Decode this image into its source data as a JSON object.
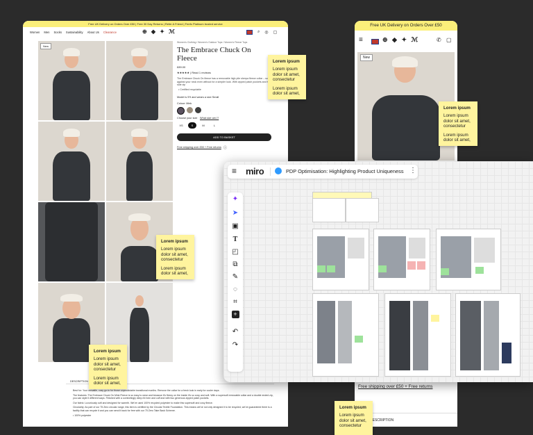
{
  "desktop": {
    "promo": "Free UK Delivery on Orders Over £50 | Free 30 Day Returns | Refer A Friend | Feefo Platinum trusted service",
    "nav": [
      "Women",
      "Men",
      "Socks",
      "Sustainability",
      "About Us",
      "Clearance"
    ],
    "logo": "⊕ ◆ ✦ ℳ",
    "new_badge": "New",
    "breadcrumb": "Women's Clothing / Women's Outdoor Tops / Women's Fleece Tops",
    "product_title": "The Embrace Chuck On Fleece",
    "price": "£89.00",
    "reviews": "★★★★★ | Read 1 reviews",
    "description": "The Embrace Chuck On fleece has a removable high pile sherpa fleece collar – so cosy against your neck even without for a simpler look. With zipped patch pockets and two side zip",
    "bullet": "• Certified recyclable",
    "model_text": "Model is 5'9 and wears a size Small",
    "colour_label": "Colour: Mink",
    "size_label": "Choose your size",
    "size_guide": "What size am I?",
    "sizes": [
      "XS",
      "S",
      "M",
      "L"
    ],
    "add_to_basket": "ADD TO BASKET",
    "free_shipping": "Free shipping over £50 + Free returns",
    "tab_description": "DESCRIPTION",
    "body_text": [
      "Best for: Your versatile, cosy go-to for those unpredictable transitional months. Remove the collar for a fresh look in early for cooler days.",
      "The features: The Embrace Chuck On Mink Fleece is so easy to wear and because it's fleecy on the inside it's so cosy and soft. With a supersoft removable collar and a double ended zip, you can style it different ways. Finished with a comfortingly deep rib hem and cuff and with two generous zipped patch pockets.",
      "Our fabric: Luxuriously soft and designed for warmth. We've used 100% recycled polyester to make this supersoft and cosy fleece.",
      "Circularity: As part of our 75 Zero circular range, this item is certified by the Circular Textile Foundation. This means we've not only designed it to be recycled, we've guaranteed there is a facility that can recycle it and you can send it back for free with our 75 Zero Take Back Scheme.",
      "• 100% polyester"
    ]
  },
  "mobile": {
    "promo": "Free UK Delivery on Orders Over £50",
    "new_badge": "New",
    "free_shipping": "Free shipping over £50 + Free returns",
    "tab_description": "DESCRIPTION"
  },
  "miro": {
    "logo": "miro",
    "board_title": "PDP Optimisation: Highlighting Product Uniqueness",
    "tools": [
      "sparkle-icon",
      "cursor-icon",
      "frame-icon",
      "text-icon",
      "sticky-icon",
      "shapes-icon",
      "pen-icon",
      "comment-icon",
      "crop-icon",
      "add-icon",
      "undo-icon",
      "redo-icon"
    ]
  },
  "stickies": [
    {
      "title": "Lorem ipsum",
      "line1": "Lorem ipsum dolor sit amet, consectetur",
      "line2": "Lorem ipsum dolor sit amet,"
    },
    {
      "title": "Lorem ipsum",
      "line1": "Lorem ipsum dolor sit amet, consectetur",
      "line2": "Lorem ipsum dolor sit amet,"
    },
    {
      "title": "Lorem ipsum",
      "line1": "Lorem ipsum dolor sit amet, consectetur",
      "line2": "Lorem ipsum dolor sit amet,"
    },
    {
      "title": "Lorem ipsum",
      "line1": "Lorem ipsum dolor sit amet, consectetur",
      "line2": "Lorem ipsum dolor sit amet,"
    },
    {
      "title": "Lorem ipsum",
      "line1": "Lorem ipsum dolor sit amet, consectetur",
      "line2": ""
    }
  ],
  "colors": {
    "background": "#2b2b2b",
    "promo_yellow": "#fbef7a",
    "sticky_yellow": "#fff49e",
    "miro_accent": "#4262ff"
  }
}
